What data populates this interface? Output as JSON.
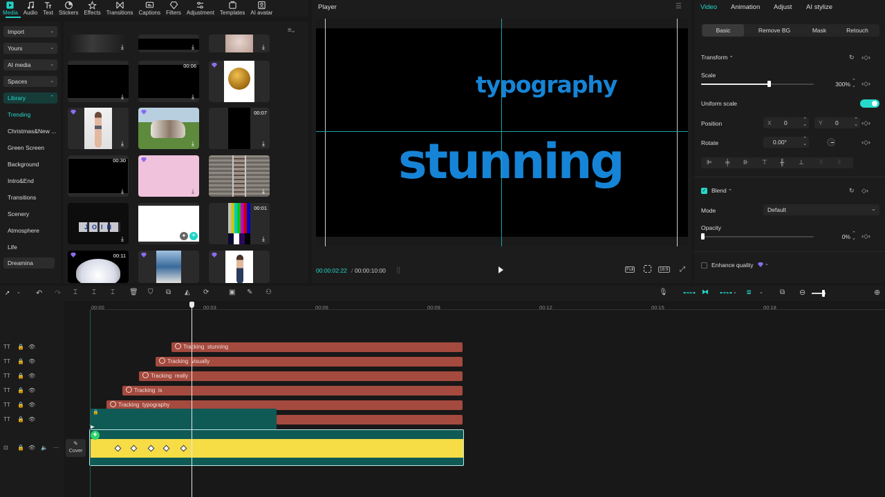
{
  "toolbar": [
    {
      "label": "Media",
      "icon": "media-icon",
      "active": true
    },
    {
      "label": "Audio",
      "icon": "audio-icon"
    },
    {
      "label": "Text",
      "icon": "text-icon"
    },
    {
      "label": "Stickers",
      "icon": "stickers-icon"
    },
    {
      "label": "Effects",
      "icon": "effects-icon"
    },
    {
      "label": "Transitions",
      "icon": "transitions-icon"
    },
    {
      "label": "Captions",
      "icon": "captions-icon"
    },
    {
      "label": "Filters",
      "icon": "filters-icon"
    },
    {
      "label": "Adjustment",
      "icon": "adjustment-icon"
    },
    {
      "label": "Templates",
      "icon": "templates-icon"
    },
    {
      "label": "AI avatar",
      "icon": "ai-avatar-icon"
    }
  ],
  "leftnav": {
    "dropdowns": [
      "Import",
      "Yours",
      "AI media",
      "Spaces",
      "Library"
    ],
    "library_items": [
      "Trending",
      "Christmas&New ...",
      "Green Screen",
      "Background",
      "Intro&End",
      "Transitions",
      "Scenery",
      "Atmosphere",
      "Life"
    ],
    "dreamina": "Dreamina"
  },
  "media": {
    "durations": [
      "00:06",
      "00:07",
      "00:30",
      "00:01",
      "00:11"
    ]
  },
  "player": {
    "title": "Player",
    "text_top": "typography",
    "text_main": "stunning",
    "time_current": "00:00:02:22",
    "time_total": "00:00:10:00",
    "btn_full": "Full",
    "btn_ratio": "16:9"
  },
  "props": {
    "tabs": [
      "Video",
      "Animation",
      "Adjust",
      "AI stylize"
    ],
    "subtabs": [
      "Basic",
      "Remove BG",
      "Mask",
      "Retouch"
    ],
    "transform": "Transform",
    "scale_label": "Scale",
    "scale_value": "300%",
    "scale_fraction": 0.6,
    "uniform_scale": "Uniform scale",
    "position_label": "Position",
    "pos_x_label": "X",
    "pos_x": "0",
    "pos_y_label": "Y",
    "pos_y": "0",
    "rotate_label": "Rotate",
    "rotate_value": "0.00°",
    "blend": "Blend",
    "mode_label": "Mode",
    "mode_value": "Default",
    "opacity_label": "Opacity",
    "opacity_value": "0%",
    "enhance": "Enhance quality",
    "accent": "#26d9cb"
  },
  "timeline": {
    "ruler": [
      "00:00",
      "00:03",
      "00:06",
      "00:09",
      "00:12",
      "00:15",
      "00:18"
    ],
    "clips": [
      {
        "prefix": "Tracking",
        "word": "stunning"
      },
      {
        "prefix": "Tracking",
        "word": "visually"
      },
      {
        "prefix": "Tracking",
        "word": "really"
      },
      {
        "prefix": "Tracking",
        "word": "is"
      },
      {
        "prefix": "Tracking",
        "word": "typography"
      }
    ],
    "cover": "Cover",
    "clip_color": "#a44a3e",
    "main_clip_color": "#f6dc45"
  }
}
